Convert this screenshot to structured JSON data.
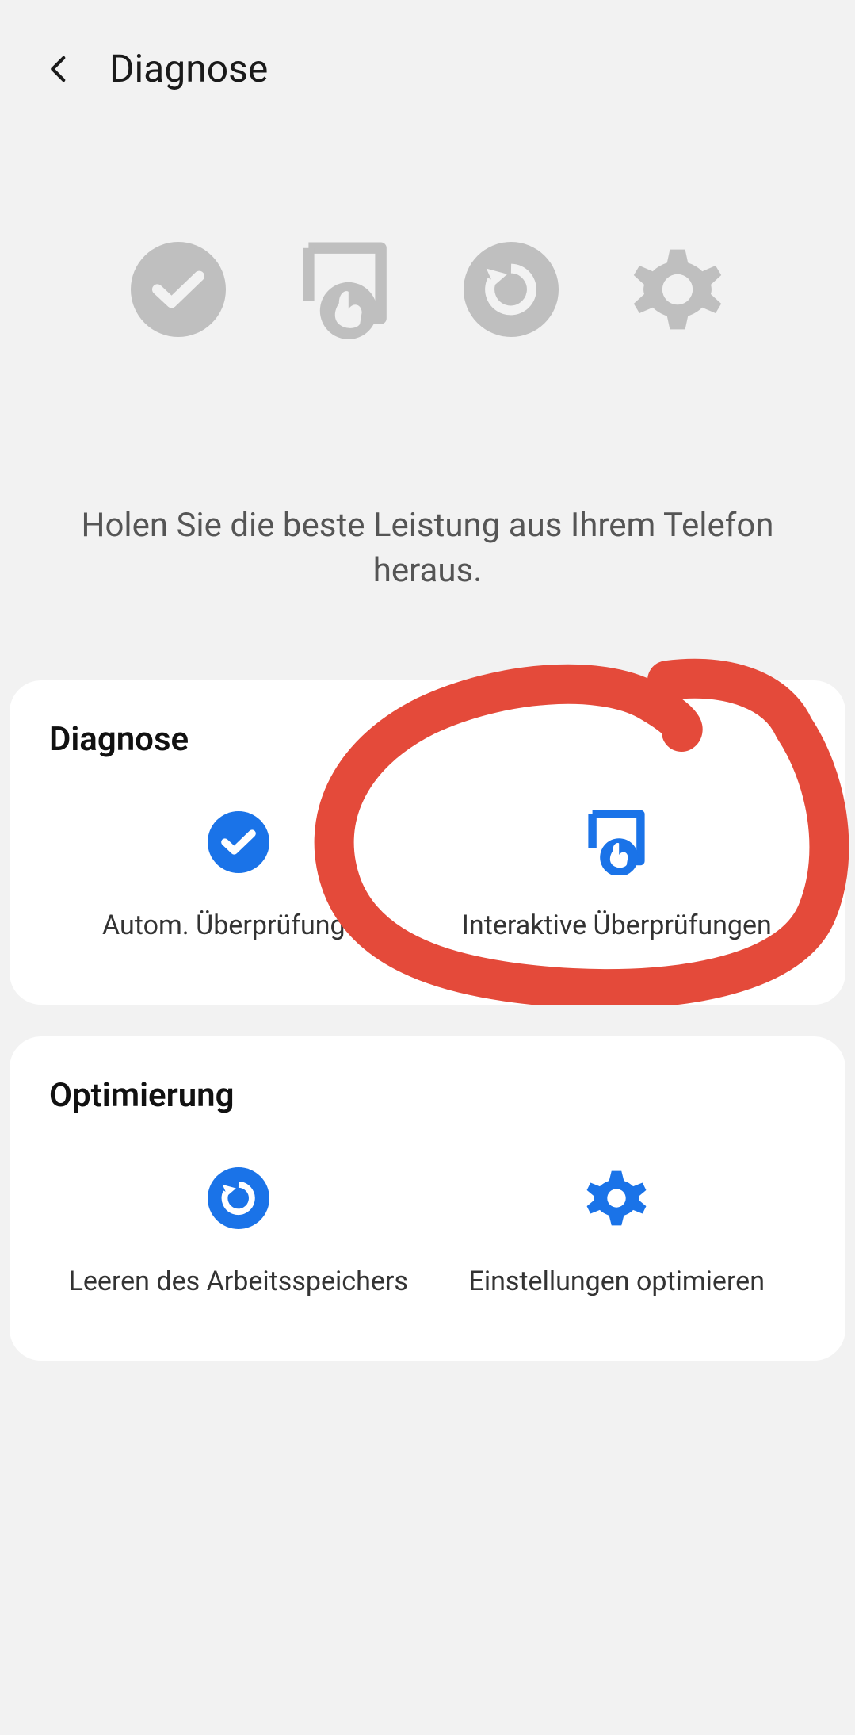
{
  "header": {
    "title": "Diagnose"
  },
  "hero": {
    "subtitle": "Holen Sie die beste Leistung aus Ihrem Telefon heraus."
  },
  "sections": {
    "diagnose": {
      "title": "Diagnose",
      "auto_checks_label": "Autom. Überprüfungen",
      "interactive_checks_label": "Interaktive Überprüfungen"
    },
    "optimize": {
      "title": "Optimierung",
      "clear_memory_label": "Leeren des Arbeitsspeichers",
      "optimize_settings_label": "Einstellungen optimieren"
    }
  },
  "colors": {
    "accent": "#1a73e8",
    "hero_icon": "#bfbfbf",
    "card_bg": "#ffffff",
    "page_bg": "#f2f2f2",
    "annotation": "#e44a3a"
  }
}
